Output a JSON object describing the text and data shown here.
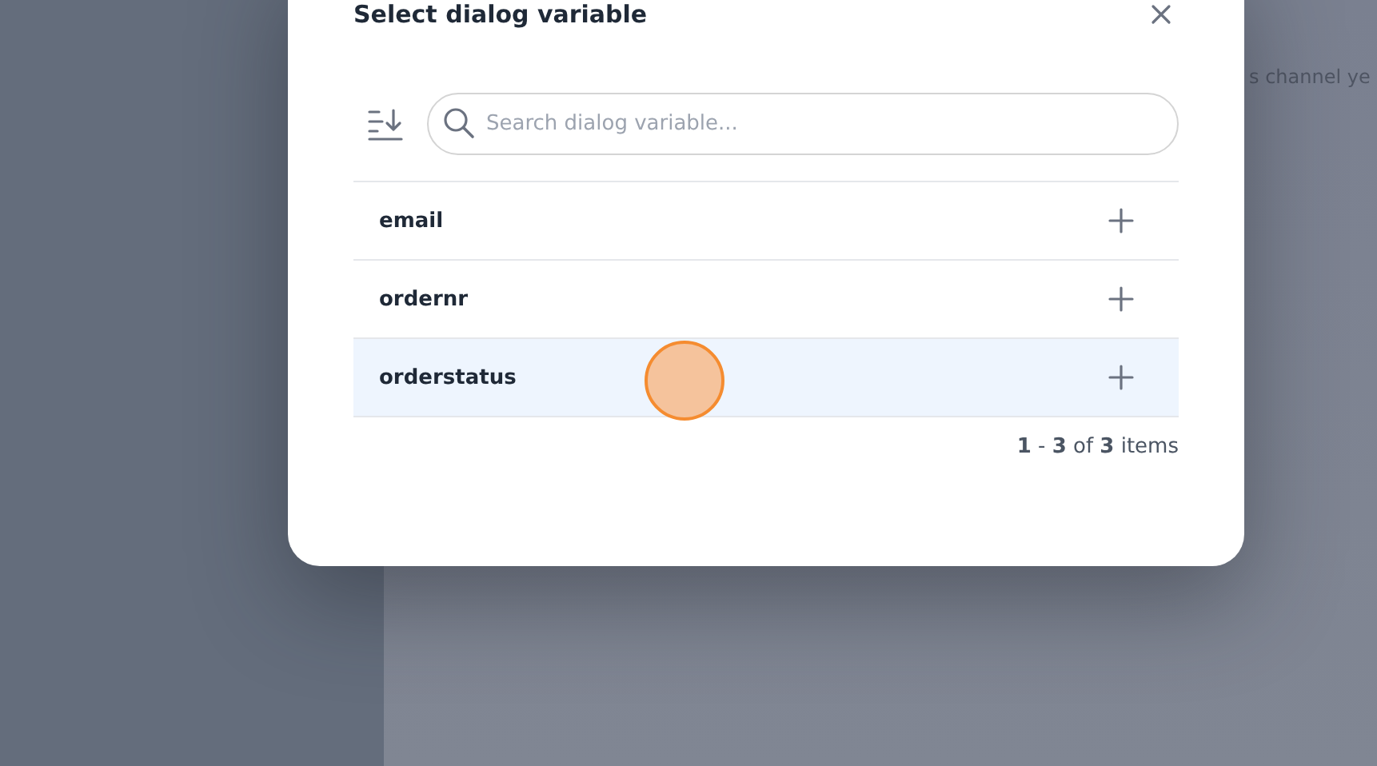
{
  "background": {
    "text": "s channel ye"
  },
  "dialog": {
    "title": "Select dialog variable",
    "search": {
      "placeholder": "Search dialog variable..."
    },
    "items": [
      {
        "name": "email",
        "highlighted": false
      },
      {
        "name": "ordernr",
        "highlighted": false
      },
      {
        "name": "orderstatus",
        "highlighted": true
      }
    ],
    "pagination": "**1** - **3** of **3** items"
  }
}
